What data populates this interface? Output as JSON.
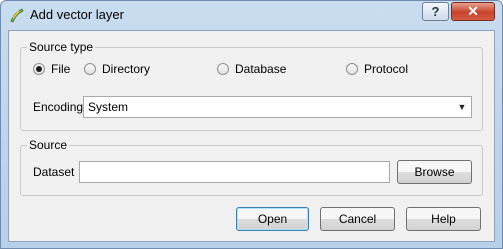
{
  "window": {
    "title": "Add vector layer",
    "help_label": "?",
    "close_label": "✕"
  },
  "source_type": {
    "legend": "Source type",
    "options": [
      "File",
      "Directory",
      "Database",
      "Protocol"
    ],
    "selected": "File",
    "encoding_label": "Encoding",
    "encoding_value": "System"
  },
  "source": {
    "legend": "Source",
    "dataset_label": "Dataset",
    "dataset_value": "",
    "browse_label": "Browse"
  },
  "buttons": {
    "open": "Open",
    "cancel": "Cancel",
    "help": "Help"
  }
}
